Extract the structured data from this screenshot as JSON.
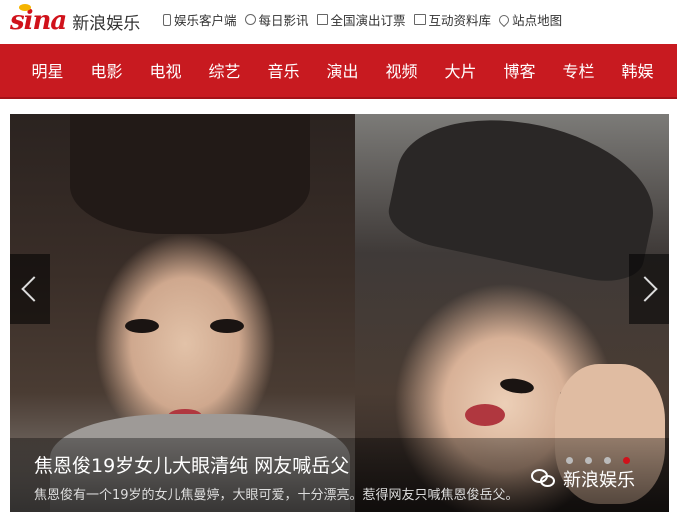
{
  "header": {
    "logo_sina": "sina",
    "logo_cn": "新浪娱乐",
    "links": [
      {
        "label": "娱乐客户端",
        "icon": "phone-icon"
      },
      {
        "label": "每日影讯",
        "icon": "film-reel-icon"
      },
      {
        "label": "全国演出订票",
        "icon": "ticket-icon"
      },
      {
        "label": "互动资料库",
        "icon": "book-icon"
      },
      {
        "label": "站点地图",
        "icon": "location-pin-icon"
      }
    ]
  },
  "nav": {
    "items": [
      "明星",
      "电影",
      "电视",
      "综艺",
      "音乐",
      "演出",
      "视频",
      "大片",
      "博客",
      "专栏",
      "韩娱"
    ]
  },
  "slider": {
    "title": "焦恩俊19岁女儿大眼清纯 网友喊岳父",
    "description": "焦恩俊有一个19岁的女儿焦曼婷，大眼可爱，十分漂亮。惹得网友只喊焦恩俊岳父。",
    "watermark": "新浪娱乐",
    "active_slide": 4,
    "slide_count": 4
  },
  "colors": {
    "brand_red": "#c81a20",
    "active_dot": "#d0121b"
  }
}
